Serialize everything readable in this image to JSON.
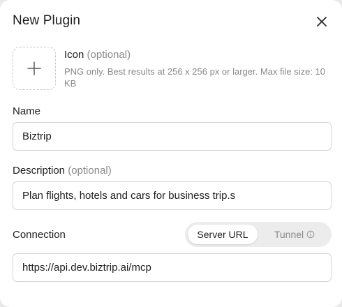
{
  "dialog": {
    "title": "New Plugin",
    "close_icon": "close-icon"
  },
  "icon_section": {
    "label": "Icon",
    "optional": "(optional)",
    "help": "PNG only. Best results at 256 x 256 px or larger. Max file size: 10 KB",
    "upload_icon": "plus-icon"
  },
  "name": {
    "label": "Name",
    "value": "Biztrip"
  },
  "description": {
    "label": "Description",
    "optional": "(optional)",
    "value": "Plan flights, hotels and cars for business trip.s"
  },
  "connection": {
    "label": "Connection",
    "options": [
      "Server URL",
      "Tunnel"
    ],
    "selected": "Server URL",
    "tunnel_info_icon": "info-icon",
    "value": "https://api.dev.biztrip.ai/mcp"
  }
}
